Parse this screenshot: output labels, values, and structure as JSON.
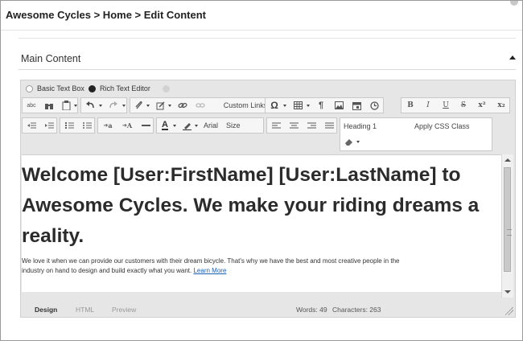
{
  "header": {
    "breadcrumb": "Awesome Cycles > Home > Edit Content"
  },
  "section": {
    "title": "Main Content"
  },
  "editor_modes": {
    "basic": "Basic Text Box",
    "rich": "Rich Text Editor",
    "selected": "rich"
  },
  "toolbar": {
    "custom_links": "Custom Links",
    "font_name": "Arial",
    "font_size": "Size",
    "paragraph_format": "Heading 1",
    "css_class": "Apply CSS Class",
    "bold": "B",
    "italic": "I",
    "underline": "U",
    "strike": "S",
    "superscript": "x²",
    "subscript": "x₂",
    "spellcheck": "abc",
    "indent_text_a": "a",
    "indent_text_A": "A",
    "font_color_letter": "A"
  },
  "content": {
    "heading": "Welcome [User:FirstName] [User:LastName] to Awesome Cycles. We make your riding dreams a reality.",
    "paragraph": "We love it when we can provide our customers with their dream bicycle. That's why we have the best and most creative people in the industry on hand to design and build exactly what you want.",
    "link": "Learn More"
  },
  "status": {
    "tabs": [
      "Design",
      "HTML",
      "Preview"
    ],
    "active_tab": "Design",
    "words": "Words: 49",
    "characters": "Characters: 263"
  },
  "colors": {
    "link": "#1a5fb4",
    "toolbar_bg": "#f6f6f6",
    "editor_frame": "#e6e6e6"
  }
}
